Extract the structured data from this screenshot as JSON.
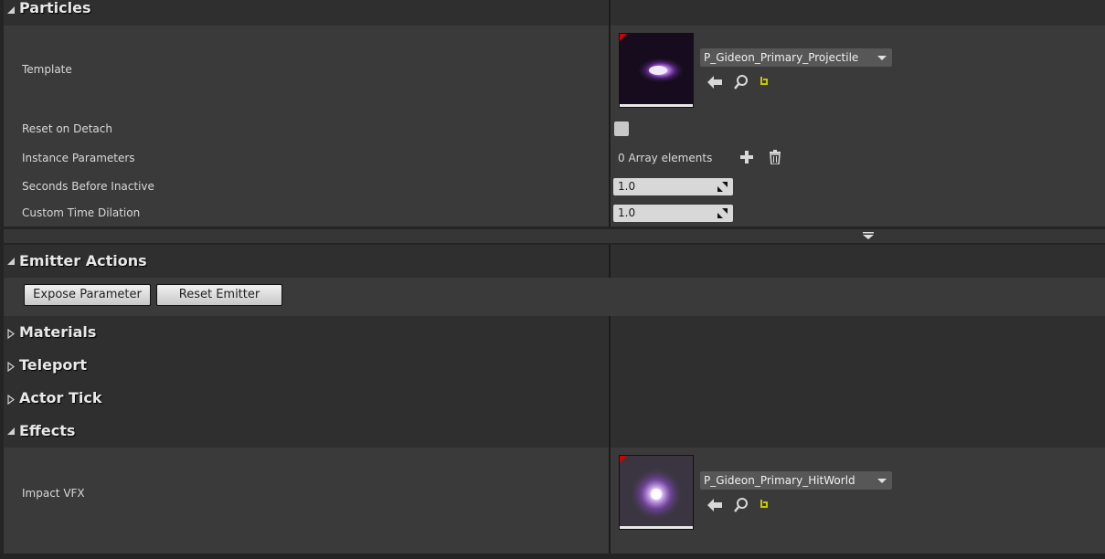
{
  "sections": {
    "particles": "Particles",
    "emitter_actions": "Emitter Actions",
    "materials": "Materials",
    "teleport": "Teleport",
    "actor_tick": "Actor Tick",
    "effects": "Effects"
  },
  "particles": {
    "template_label": "Template",
    "template_value": "P_Gideon_Primary_Projectile",
    "reset_on_detach_label": "Reset on Detach",
    "reset_on_detach_checked": false,
    "instance_parameters_label": "Instance Parameters",
    "instance_parameters_value": "0 Array elements",
    "seconds_before_inactive_label": "Seconds Before Inactive",
    "seconds_before_inactive_value": "1.0",
    "custom_time_dilation_label": "Custom Time Dilation",
    "custom_time_dilation_value": "1.0"
  },
  "emitter_actions": {
    "expose_parameter": "Expose Parameter",
    "reset_emitter": "Reset Emitter"
  },
  "effects": {
    "impact_vfx_label": "Impact VFX",
    "impact_vfx_value": "P_Gideon_Primary_HitWorld"
  },
  "icons": [
    "expand-triangle-icon",
    "collapse-triangle-icon",
    "use-selected-arrow-icon",
    "browse-magnifier-icon",
    "reset-to-default-icon",
    "add-plus-icon",
    "delete-trash-icon",
    "advanced-expand-icon"
  ],
  "colors": {
    "accent_corner": "#d10000",
    "reset_icon": "#c8c800",
    "particle_glow": "#c070ff"
  }
}
